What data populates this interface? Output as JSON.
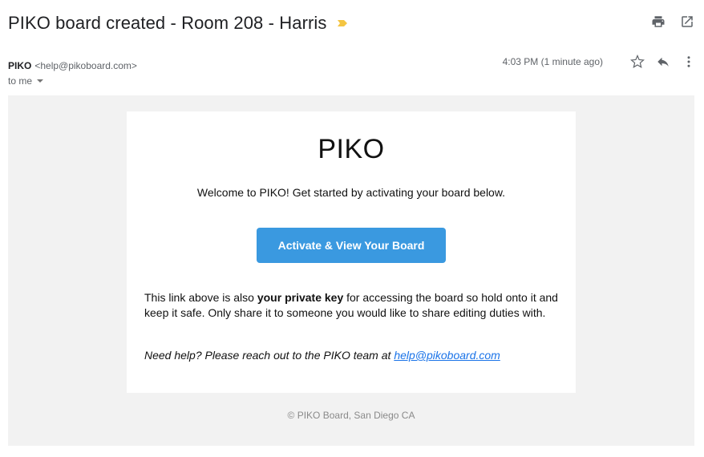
{
  "subject": "PIKO board created - Room 208 - Harris",
  "header": {
    "sender_name": "PIKO",
    "sender_email": "<help@pikoboard.com>",
    "time": "4:03 PM (1 minute ago)",
    "to": "to me"
  },
  "icons": {
    "importance": "importance-marker-icon",
    "print": "print-icon",
    "new_window": "open-in-new-window-icon",
    "star": "star-icon",
    "reply": "reply-icon",
    "more": "more-vertical-icon"
  },
  "colors": {
    "importance": "#f4c542",
    "cta": "#3a99e0",
    "link": "#1a73e8",
    "outer_background": "#f2f2f2"
  },
  "email": {
    "logo": "PIKO",
    "welcome": "Welcome to PIKO! Get started by activating your board below.",
    "cta_label": "Activate & View Your Board",
    "private_text_1": "This link above is also ",
    "private_bold": "your private key",
    "private_text_2": " for accessing the board so hold onto it and keep it safe. Only share it to someone you would like to share editing duties with.",
    "help_text": "Need help? Please reach out to the PIKO team at ",
    "help_link": "help@pikoboard.com",
    "footer": "© PIKO Board, San Diego CA"
  }
}
